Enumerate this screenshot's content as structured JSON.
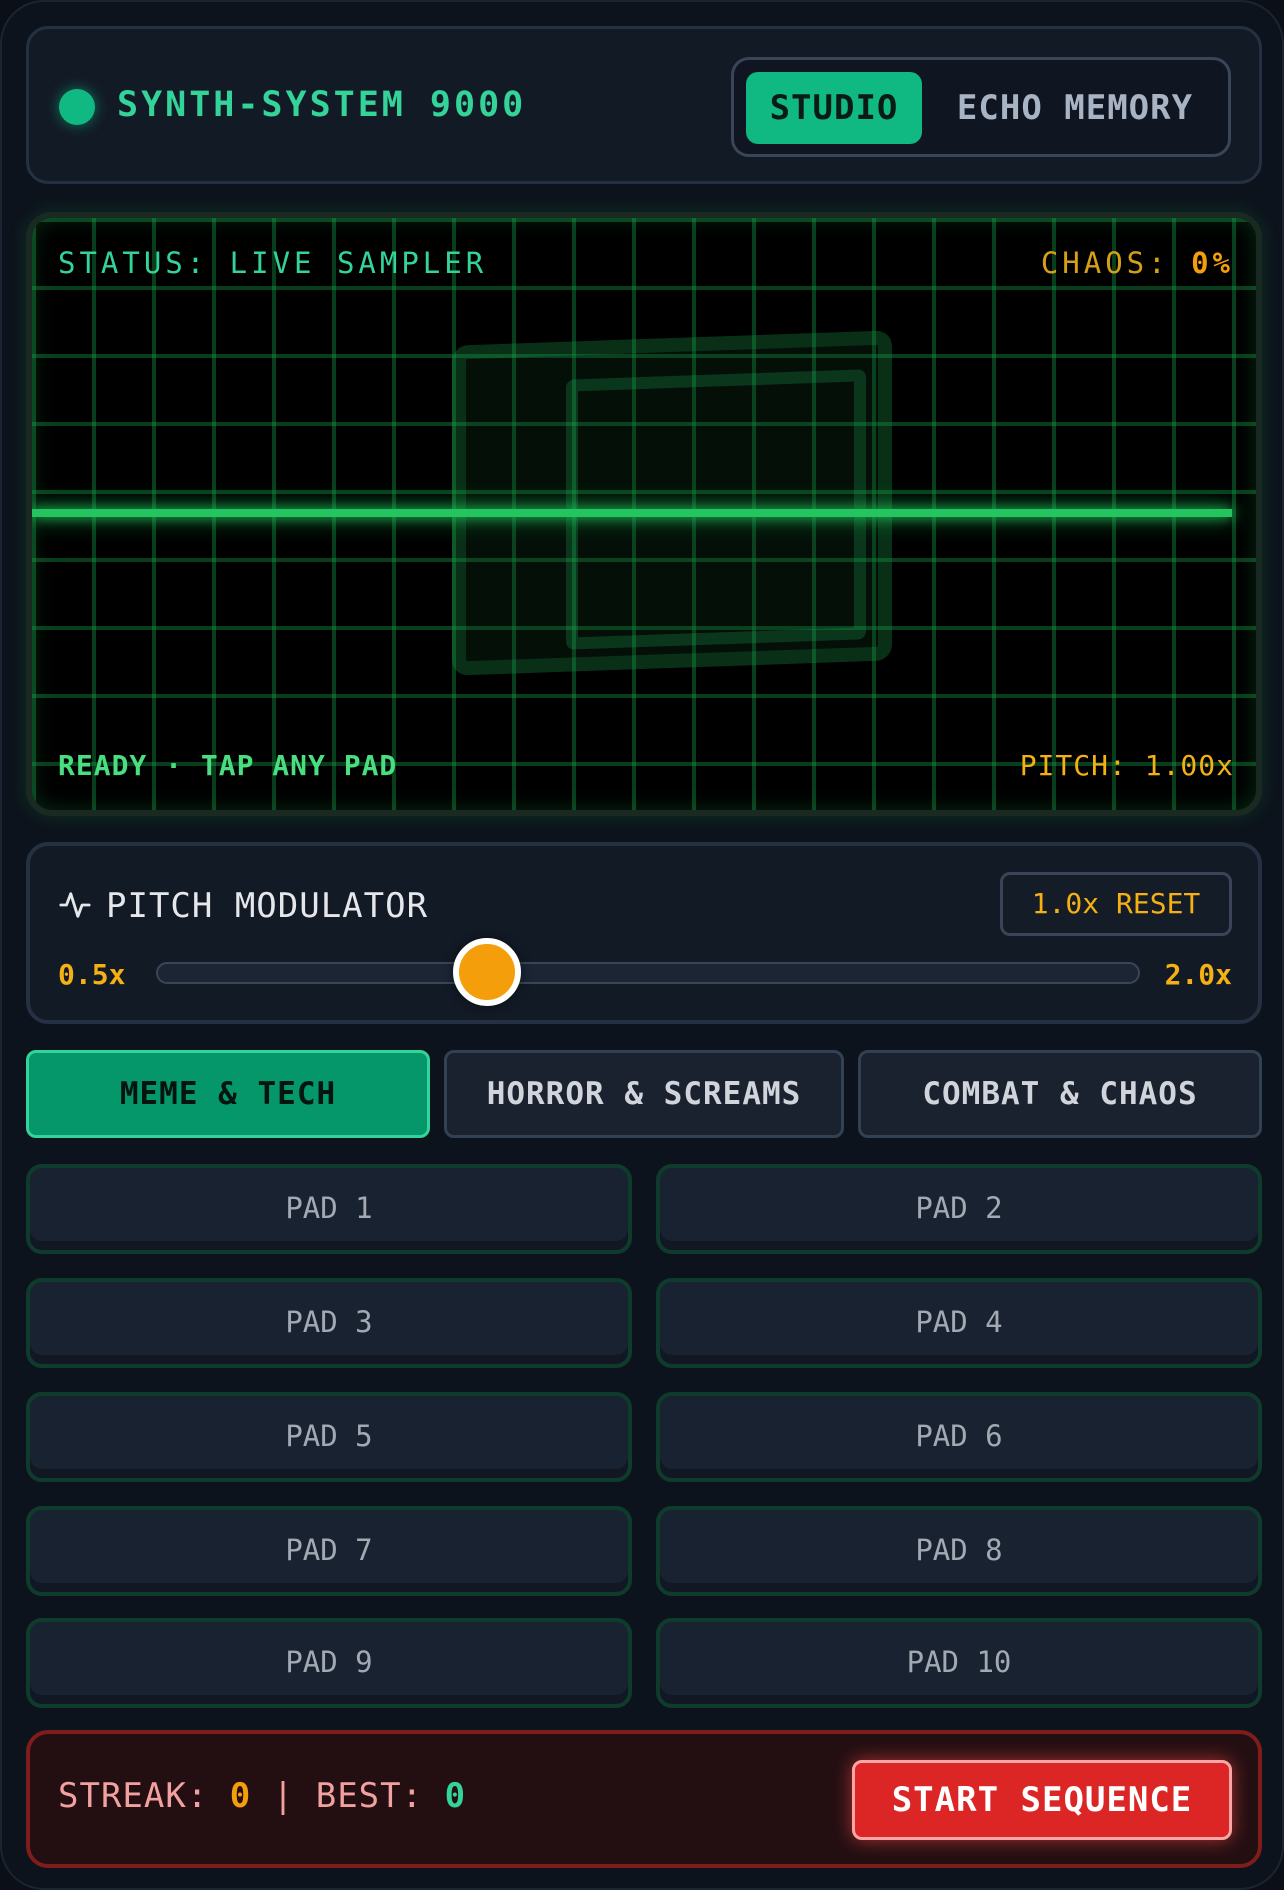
{
  "header": {
    "title": "SYNTH-SYSTEM 9000",
    "modes": [
      "STUDIO",
      "ECHO MEMORY"
    ],
    "active_mode": "STUDIO"
  },
  "scope": {
    "status": "STATUS: LIVE SAMPLER",
    "chaos_label": "CHAOS:",
    "chaos_value": "0%",
    "message": "READY · TAP ANY PAD",
    "pitch_readout": "PITCH: 1.00x"
  },
  "pitch_modulator": {
    "title": "PITCH MODULATOR",
    "reset_label": "1.0x RESET",
    "min_label": "0.5x",
    "max_label": "2.0x",
    "min": 0.5,
    "max": 2.0,
    "value": 1.0
  },
  "categories": [
    {
      "label": "MEME & TECH",
      "active": true
    },
    {
      "label": "HORROR & SCREAMS",
      "active": false
    },
    {
      "label": "COMBAT & CHAOS",
      "active": false
    }
  ],
  "pads": [
    "PAD 1",
    "PAD 2",
    "PAD 3",
    "PAD 4",
    "PAD 5",
    "PAD 6",
    "PAD 7",
    "PAD 8",
    "PAD 9",
    "PAD 10"
  ],
  "footer": {
    "streak_label": "STREAK:",
    "streak_value": "0",
    "separator": "|",
    "best_label": "BEST:",
    "best_value": "0",
    "start_label": "START SEQUENCE"
  },
  "colors": {
    "accent": "#10b981",
    "amber": "#f59e0b",
    "danger": "#dc2626",
    "scope_green": "#22c55e"
  }
}
